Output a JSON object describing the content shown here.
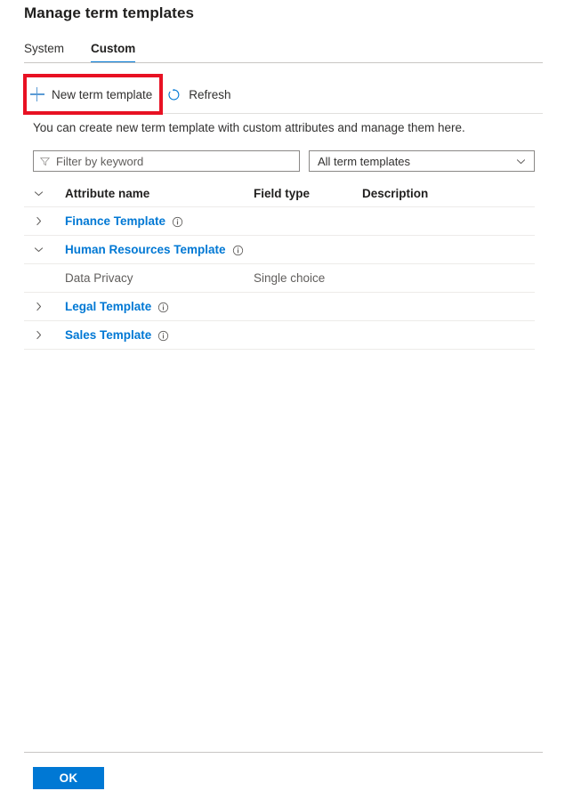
{
  "page": {
    "title": "Manage term templates"
  },
  "tabs": [
    {
      "label": "System",
      "selected": false
    },
    {
      "label": "Custom",
      "selected": true
    }
  ],
  "toolbar": {
    "new_template_label": "New term template",
    "new_template_icon": "plus-icon",
    "refresh_label": "Refresh",
    "refresh_icon": "refresh-icon"
  },
  "highlight": {
    "color": "#e81123",
    "target": "New term template"
  },
  "description": "You can create new term template with custom attributes and manage them here.",
  "filter": {
    "placeholder": "Filter by keyword",
    "value": "",
    "icon": "funnel-icon"
  },
  "dropdown": {
    "selected": "All term templates",
    "icon": "chevron-down-icon"
  },
  "table": {
    "columns": {
      "name": "Attribute name",
      "type": "Field type",
      "description": "Description"
    },
    "header_toggle_icon": "chevron-down-icon",
    "rows": [
      {
        "name": "Finance Template",
        "type": "",
        "description": "",
        "expanded": false,
        "toggle_icon": "chevron-right-icon",
        "is_link": true,
        "has_info": true,
        "child": false
      },
      {
        "name": "Human Resources Template",
        "type": "",
        "description": "",
        "expanded": true,
        "toggle_icon": "chevron-down-icon",
        "is_link": true,
        "has_info": true,
        "child": false
      },
      {
        "name": "Data Privacy",
        "type": "Single choice",
        "description": "",
        "expanded": false,
        "toggle_icon": "",
        "is_link": false,
        "has_info": false,
        "child": true
      },
      {
        "name": "Legal Template",
        "type": "",
        "description": "",
        "expanded": false,
        "toggle_icon": "chevron-right-icon",
        "is_link": true,
        "has_info": true,
        "child": false
      },
      {
        "name": "Sales Template",
        "type": "",
        "description": "",
        "expanded": false,
        "toggle_icon": "chevron-right-icon",
        "is_link": true,
        "has_info": true,
        "child": false
      }
    ]
  },
  "footer": {
    "ok_label": "OK"
  },
  "colors": {
    "accent": "#0078d4",
    "link": "#0078d4",
    "highlight": "#e81123",
    "text": "#323130",
    "muted": "#605e5c",
    "border": "#e1dfdd"
  }
}
